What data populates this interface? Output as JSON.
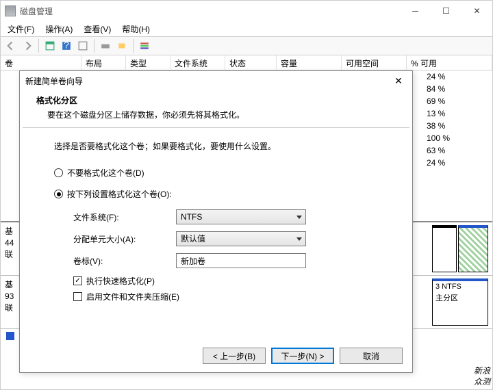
{
  "window": {
    "title": "磁盘管理",
    "menu": {
      "file": "文件(F)",
      "action": "操作(A)",
      "view": "查看(V)",
      "help": "帮助(H)"
    },
    "headers": {
      "volume": "卷",
      "layout": "布局",
      "type": "类型",
      "fs": "文件系统",
      "status": "状态",
      "capacity": "容量",
      "free": "可用空间",
      "pct": "% 可用"
    },
    "pct_values": [
      "24 %",
      "84 %",
      "69 %",
      "13 %",
      "38 %",
      "100 %",
      "63 %",
      "24 %"
    ],
    "disk1": {
      "line1": "基",
      "line2": "44",
      "line3": "联"
    },
    "disk2": {
      "line1": "基",
      "line2": "93",
      "line3": "联",
      "part_label1": "3 NTFS",
      "part_label2": "主分区"
    },
    "legend": "",
    "watermark1": "新浪",
    "watermark2": "众测"
  },
  "dialog": {
    "title": "新建简单卷向导",
    "heading": "格式化分区",
    "subheading": "要在这个磁盘分区上储存数据，你必须先将其格式化。",
    "prompt": "选择是否要格式化这个卷；如果要格式化，要使用什么设置。",
    "radio_noformat": "不要格式化这个卷(D)",
    "radio_format": "按下列设置格式化这个卷(O):",
    "label_fs": "文件系统(F):",
    "value_fs": "NTFS",
    "label_alloc": "分配单元大小(A):",
    "value_alloc": "默认值",
    "label_vol": "卷标(V):",
    "value_vol": "新加卷",
    "chk_quick": "执行快速格式化(P)",
    "chk_compress": "启用文件和文件夹压缩(E)",
    "btn_back": "< 上一步(B)",
    "btn_next": "下一步(N) >",
    "btn_cancel": "取消"
  }
}
